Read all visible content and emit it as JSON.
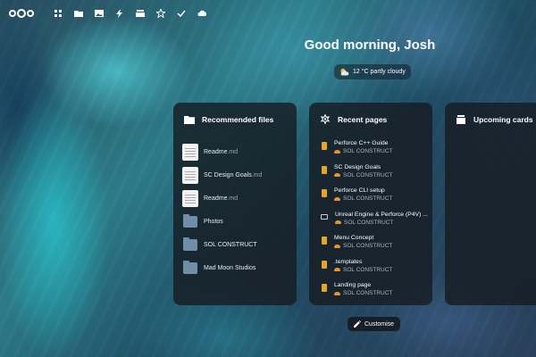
{
  "greeting": "Good morning, Josh",
  "weather": {
    "text": "12 °C partly cloudy"
  },
  "nav": {
    "items": [
      {
        "icon": "dashboard-icon"
      },
      {
        "icon": "files-icon"
      },
      {
        "icon": "photos-icon"
      },
      {
        "icon": "activity-icon"
      },
      {
        "icon": "deck-icon"
      },
      {
        "icon": "starred-icon"
      },
      {
        "icon": "tasks-icon"
      },
      {
        "icon": "cloud-icon"
      }
    ]
  },
  "recommended": {
    "title": "Recommended files",
    "items": [
      {
        "name": "Readme",
        "ext": ".md",
        "kind": "file"
      },
      {
        "name": "SC Design Goals",
        "ext": ".md",
        "kind": "file"
      },
      {
        "name": "Readme",
        "ext": ".md",
        "kind": "file"
      },
      {
        "name": "Photos",
        "ext": "",
        "kind": "folder"
      },
      {
        "name": "SOL CONSTRUCT",
        "ext": "",
        "kind": "folder"
      },
      {
        "name": "Mad Moon Studios",
        "ext": "",
        "kind": "folder"
      }
    ]
  },
  "recent": {
    "title": "Recent pages",
    "items": [
      {
        "title": "Perforce C++ Guide",
        "collective": "SOL CONSTRUCT",
        "icon": "page"
      },
      {
        "title": "SC Design Goals",
        "collective": "SOL CONSTRUCT",
        "icon": "page"
      },
      {
        "title": "Perforce CLI setup",
        "collective": "SOL CONSTRUCT",
        "icon": "page"
      },
      {
        "title": "Unreal Engine & Perforce (P4V) ...",
        "collective": "SOL CONSTRUCT",
        "icon": "screen"
      },
      {
        "title": "Menu Concept",
        "collective": "SOL CONSTRUCT",
        "icon": "page"
      },
      {
        "title": ".templates",
        "collective": "SOL CONSTRUCT",
        "icon": "page"
      },
      {
        "title": "Landing page",
        "collective": "SOL CONSTRUCT",
        "icon": "page"
      }
    ]
  },
  "upcoming": {
    "title": "Upcoming cards"
  },
  "customise": {
    "label": "Customise"
  }
}
